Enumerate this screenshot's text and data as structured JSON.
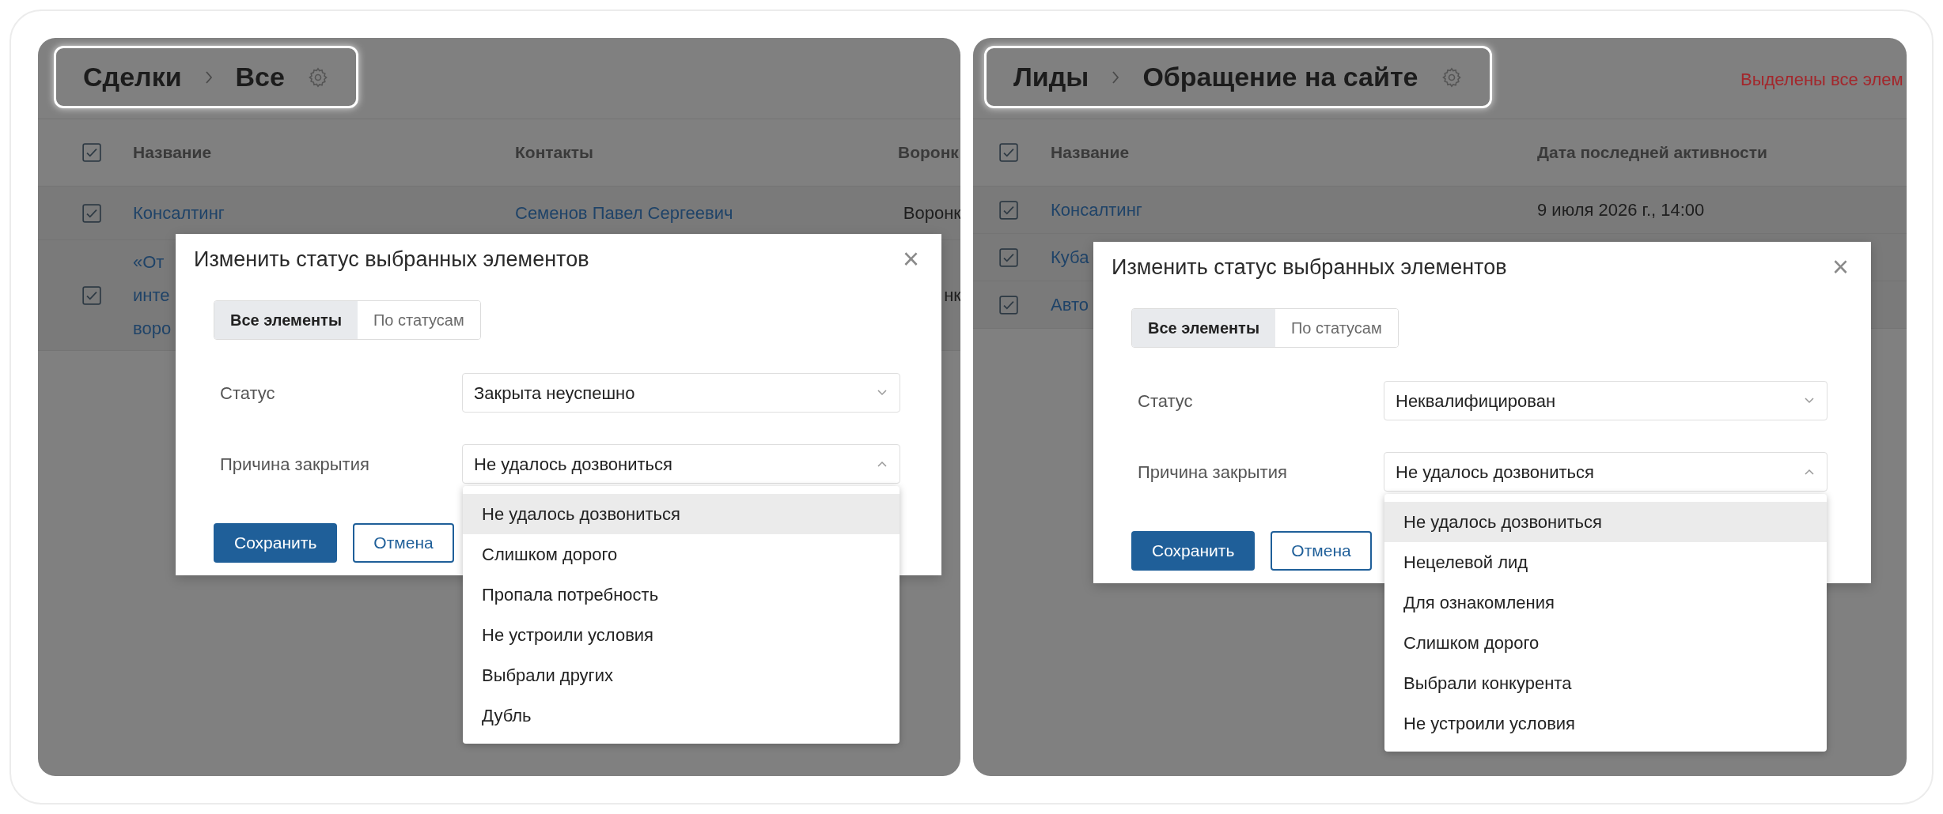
{
  "panels": [
    {
      "breadcrumb": [
        "Сделки",
        "Все"
      ],
      "table": {
        "columns": [
          "Название",
          "Контакты",
          "Воронк"
        ],
        "header_checked": true,
        "rows": [
          {
            "checked": true,
            "cells": [
              {
                "kind": "link",
                "text": "Консалтинг"
              },
              {
                "kind": "link",
                "text": "Семенов Павел Сергеевич"
              },
              {
                "kind": "plain",
                "text": "Воронк"
              }
            ]
          },
          {
            "checked": true,
            "cells": [
              {
                "kind": "link",
                "text": "«От\nинте\nворо"
              },
              {
                "kind": "covered"
              },
              {
                "kind": "plain",
                "text": "нк"
              }
            ]
          }
        ]
      },
      "dialog": {
        "title": "Изменить статус выбранных элементов",
        "close": "×",
        "tabs": [
          {
            "label": "Все элементы",
            "selected": true
          },
          {
            "label": "По статусам",
            "selected": false
          }
        ],
        "fields": [
          {
            "label": "Статус",
            "value": "Закрыта неуспешно",
            "expanded": false
          },
          {
            "label": "Причина закрытия",
            "value": "Не удалось дозвониться",
            "expanded": true
          }
        ],
        "options": [
          {
            "label": "Не удалось дозвониться",
            "highlighted": true
          },
          {
            "label": "Слишком дорого",
            "highlighted": false
          },
          {
            "label": "Пропала потребность",
            "highlighted": false
          },
          {
            "label": "Не устроили условия",
            "highlighted": false
          },
          {
            "label": "Выбрали других",
            "highlighted": false
          },
          {
            "label": "Дубль",
            "highlighted": false
          }
        ],
        "buttons": [
          {
            "kind": "primary",
            "label": "Сохранить"
          },
          {
            "kind": "secondary",
            "label": "Отмена"
          }
        ]
      }
    },
    {
      "breadcrumb": [
        "Лиды",
        "Обращение на сайте"
      ],
      "notice": "Выделены все элем",
      "table": {
        "columns": [
          "Название",
          "Дата последней активности"
        ],
        "header_checked": true,
        "rows": [
          {
            "checked": true,
            "cells": [
              {
                "kind": "link",
                "text": "Консалтинг"
              },
              {
                "kind": "plain",
                "text": "9 июля 2026 г., 14:00"
              }
            ]
          },
          {
            "checked": true,
            "cells": [
              {
                "kind": "link",
                "text": "Куба"
              }
            ]
          },
          {
            "checked": true,
            "cells": [
              {
                "kind": "link",
                "text": "Авто"
              }
            ]
          }
        ]
      },
      "dialog": {
        "title": "Изменить статус выбранных элементов",
        "close": "×",
        "tabs": [
          {
            "label": "Все элементы",
            "selected": true
          },
          {
            "label": "По статусам",
            "selected": false
          }
        ],
        "fields": [
          {
            "label": "Статус",
            "value": "Неквалифицирован",
            "expanded": false
          },
          {
            "label": "Причина закрытия",
            "value": "Не удалось дозвониться",
            "expanded": true
          }
        ],
        "options": [
          {
            "label": "Не удалось дозвониться",
            "highlighted": true
          },
          {
            "label": "Нецелевой лид",
            "highlighted": false
          },
          {
            "label": "Для ознакомления",
            "highlighted": false
          },
          {
            "label": "Слишком дорого",
            "highlighted": false
          },
          {
            "label": "Выбрали конкурента",
            "highlighted": false
          },
          {
            "label": "Не устроили условия",
            "highlighted": false
          }
        ],
        "buttons": [
          {
            "kind": "primary",
            "label": "Сохранить"
          },
          {
            "kind": "secondary",
            "label": "Отмена"
          }
        ]
      }
    }
  ]
}
